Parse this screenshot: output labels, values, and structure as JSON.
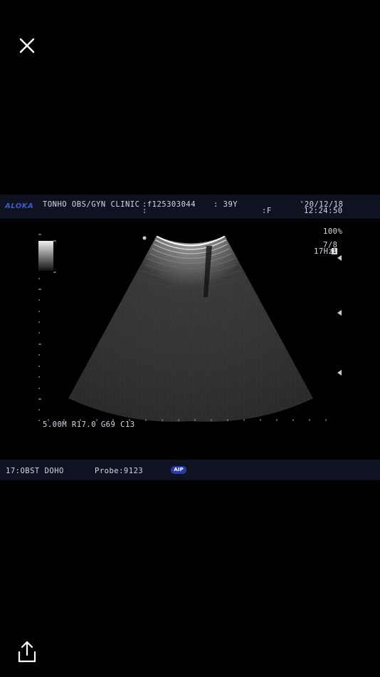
{
  "viewer": {
    "close_icon": "close-icon",
    "share_icon": "share-icon"
  },
  "header": {
    "brand": "ALOKA",
    "clinic": "TONHO OBS/GYN CLINIC",
    "patient_id": ":f125303044",
    "colon": ":",
    "age": ": 39Y",
    "sex": ":F",
    "date": "'20/12/18",
    "time": "12:24:50"
  },
  "scan": {
    "gain_pct": "100%",
    "focus": "7/8",
    "frame_rate": "17Hz",
    "frame_badge": "1",
    "params": "5.00M R17.0 G69 C13"
  },
  "footer": {
    "preset": "17:OBST DOHO",
    "probe": "Probe:9123",
    "aip_badge": "AIP"
  },
  "colors": {
    "background": "#000000",
    "bar": "#0f1220",
    "brand": "#3b5cc8",
    "text": "#d8d8e0"
  }
}
